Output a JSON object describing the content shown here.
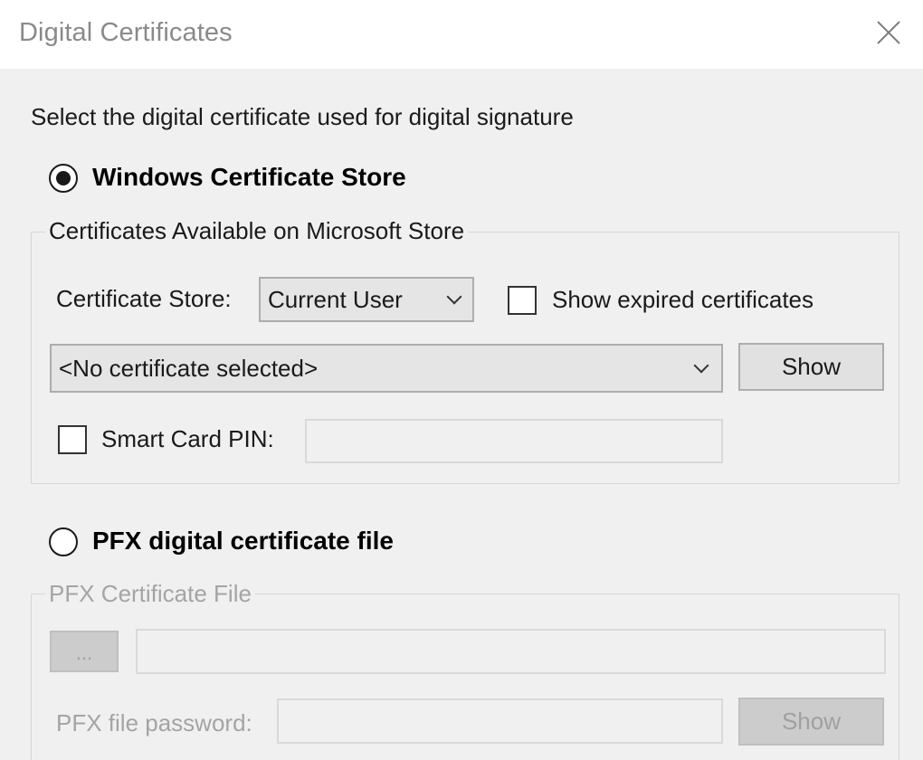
{
  "window": {
    "title": "Digital Certificates"
  },
  "intro": "Select the digital certificate used for digital signature",
  "windows_store": {
    "radio_label": "Windows Certificate Store",
    "selected": true,
    "group_title": "Certificates Available on Microsoft Store",
    "store_label": "Certificate Store:",
    "store_value": "Current User",
    "show_expired_label": "Show expired certificates",
    "show_expired_checked": false,
    "certificate_value": "<No certificate selected>",
    "show_button": "Show",
    "smart_card_label": "Smart Card PIN:",
    "smart_card_checked": false,
    "smart_card_pin_value": ""
  },
  "pfx": {
    "radio_label": "PFX digital certificate file",
    "selected": false,
    "group_title": "PFX Certificate File",
    "browse_button": "...",
    "file_path_value": "",
    "password_label": "PFX file password:",
    "password_value": "",
    "show_button": "Show"
  },
  "icons": {
    "close": "close-icon",
    "dropdown": "chevron-down-icon"
  }
}
